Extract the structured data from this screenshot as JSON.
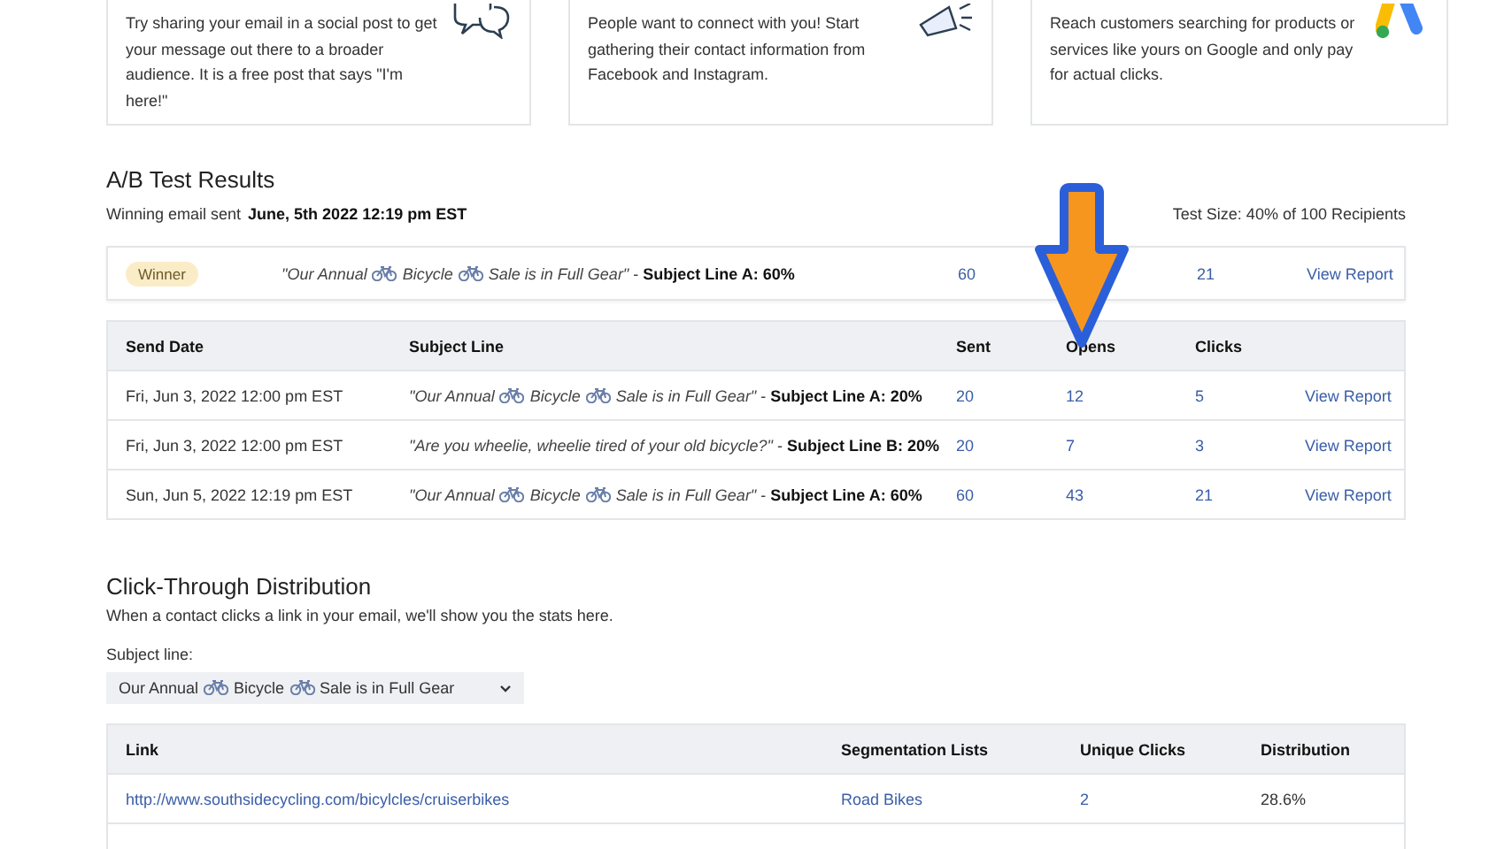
{
  "promo_cards": [
    {
      "kind": "social",
      "text": "Try sharing your email in a social post to get your message out there to a broader audience. It is a free post that says \"I'm here!\""
    },
    {
      "kind": "leads",
      "text": "People want to connect with you! Start gathering their contact information from Facebook and Instagram."
    },
    {
      "kind": "ads",
      "text": "Reach customers searching for products or services like yours on Google and only pay for actual clicks."
    }
  ],
  "ab_test": {
    "title": "A/B Test Results",
    "winning_label": "Winning email sent",
    "winning_date": "June, 5th 2022 12:19 pm EST",
    "test_size": "Test Size: 40% of 100 Recipients",
    "winner": {
      "badge": "Winner",
      "subject_parts": [
        "\"Our Annual",
        "Bicycle",
        "Sale is in Full Gear\""
      ],
      "subject_suffix": "- **Subject Line A: 60%**",
      "sent": "60",
      "clicks": "21",
      "link": "View Report"
    },
    "columns": [
      "Send Date",
      "Subject Line",
      "Sent",
      "Opens",
      "Clicks"
    ],
    "rows": [
      {
        "date": "Fri, Jun 3, 2022 12:00 pm EST",
        "subject_parts": [
          "\"Our Annual",
          "Bicycle",
          "Sale is in Full Gear\""
        ],
        "subject_suffix": "- **Subject Line A: 20%**",
        "sent": "20",
        "opens": "12",
        "clicks": "5",
        "link": "View Report"
      },
      {
        "date": "Fri, Jun 3, 2022 12:00 pm EST",
        "subject_parts": [
          "\"Are you wheelie, wheelie tired of your old bicycle?\""
        ],
        "subject_suffix": "- **Subject Line B: 20%**",
        "sent": "20",
        "opens": "7",
        "clicks": "3",
        "link": "View Report"
      },
      {
        "date": "Sun, Jun 5, 2022 12:19 pm EST",
        "subject_parts": [
          "\"Our Annual",
          "Bicycle",
          "Sale is in Full Gear\""
        ],
        "subject_suffix": "- **Subject Line A: 60%**",
        "sent": "60",
        "opens": "43",
        "clicks": "21",
        "link": "View Report"
      }
    ]
  },
  "click_through": {
    "title": "Click-Through Distribution",
    "description": "When a contact clicks a link in your email, we'll show you the stats here.",
    "select_label": "Subject line:",
    "select_parts": [
      "Our Annual",
      "Bicycle",
      "Sale is in Full Gear"
    ],
    "columns": [
      "Link",
      "Segmentation Lists",
      "Unique Clicks",
      "Distribution"
    ],
    "rows": [
      {
        "link": "http://www.southsidecycling.com/bicylcles/cruiserbikes",
        "list": "Road Bikes",
        "clicks": "2",
        "distribution": "28.6%"
      }
    ]
  }
}
